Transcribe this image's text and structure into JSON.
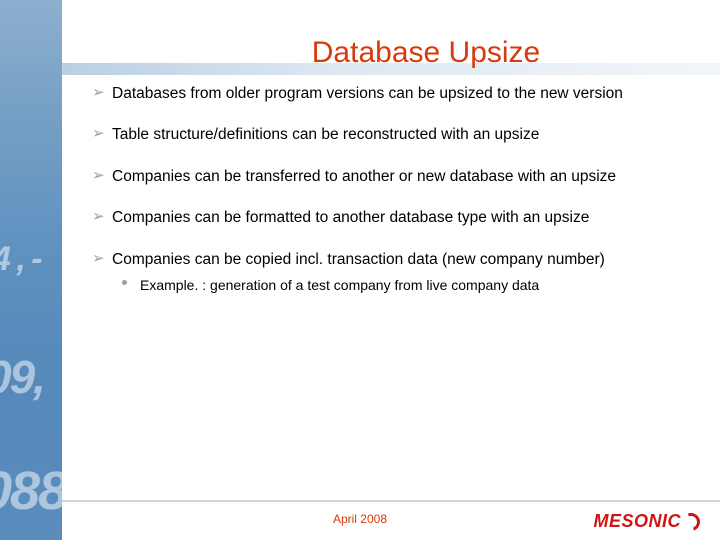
{
  "title": "Database Upsize",
  "bullets": [
    "Databases from older program versions can be upsized to the new version",
    "Table structure/definitions can be reconstructed with an upsize",
    "Companies can be transferred to another or new database with an upsize",
    "Companies can be formatted to another database type with an upsize",
    "Companies can be copied incl. transaction data (new company number)"
  ],
  "subbullet": "Example. : generation of a test company from live company data",
  "footer_date": "April 2008",
  "logo_text": "MESONIC",
  "ghost": {
    "a": "4 , -",
    "b": "09, -",
    "c": "088."
  }
}
